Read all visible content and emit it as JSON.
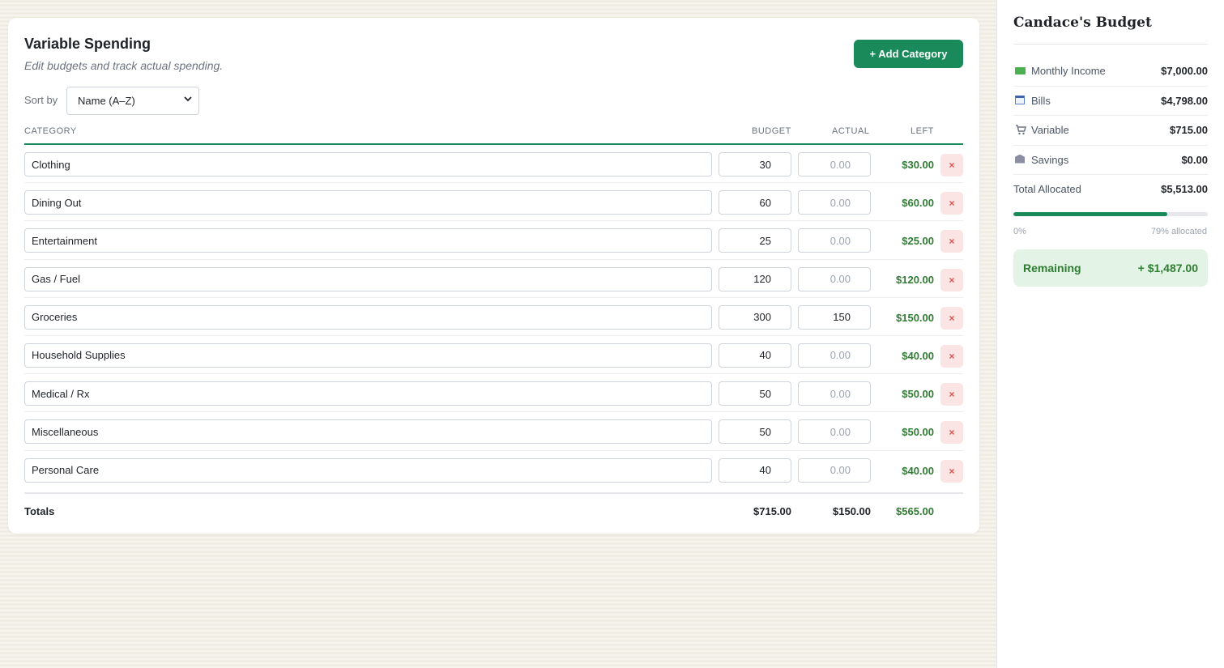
{
  "main": {
    "title": "Variable Spending",
    "subtitle": "Edit budgets and track actual spending.",
    "add_button": "+ Add Category",
    "sort_label": "Sort by",
    "sort_selected": "Name (A–Z)",
    "columns": {
      "category": "CATEGORY",
      "budget": "BUDGET",
      "actual": "ACTUAL",
      "left": "LEFT"
    },
    "rows": [
      {
        "name": "Clothing",
        "budget": "30",
        "actual": "",
        "actual_placeholder": "0.00",
        "left": "$30.00"
      },
      {
        "name": "Dining Out",
        "budget": "60",
        "actual": "",
        "actual_placeholder": "0.00",
        "left": "$60.00"
      },
      {
        "name": "Entertainment",
        "budget": "25",
        "actual": "",
        "actual_placeholder": "0.00",
        "left": "$25.00"
      },
      {
        "name": "Gas / Fuel",
        "budget": "120",
        "actual": "",
        "actual_placeholder": "0.00",
        "left": "$120.00"
      },
      {
        "name": "Groceries",
        "budget": "300",
        "actual": "150",
        "actual_placeholder": "0.00",
        "left": "$150.00"
      },
      {
        "name": "Household Supplies",
        "budget": "40",
        "actual": "",
        "actual_placeholder": "0.00",
        "left": "$40.00"
      },
      {
        "name": "Medical / Rx",
        "budget": "50",
        "actual": "",
        "actual_placeholder": "0.00",
        "left": "$50.00"
      },
      {
        "name": "Miscellaneous",
        "budget": "50",
        "actual": "",
        "actual_placeholder": "0.00",
        "left": "$50.00"
      },
      {
        "name": "Personal Care",
        "budget": "40",
        "actual": "",
        "actual_placeholder": "0.00",
        "left": "$40.00"
      }
    ],
    "delete_glyph": "×",
    "totals": {
      "label": "Totals",
      "budget": "$715.00",
      "actual": "$150.00",
      "left": "$565.00"
    }
  },
  "sidebar": {
    "title": "Candace's Budget",
    "items": [
      {
        "icon": "money-icon",
        "label": "Monthly Income",
        "value": "$7,000.00"
      },
      {
        "icon": "calendar-icon",
        "label": "Bills",
        "value": "$4,798.00"
      },
      {
        "icon": "cart-icon",
        "label": "Variable",
        "value": "$715.00"
      },
      {
        "icon": "bank-icon",
        "label": "Savings",
        "value": "$0.00"
      },
      {
        "icon": "",
        "label": "Total Allocated",
        "value": "$5,513.00"
      }
    ],
    "progress_fraction": 0.79,
    "progress_min": "0%",
    "progress_max": "79% allocated",
    "remaining_label": "Remaining",
    "remaining_value": "+ $1,487.00"
  },
  "colors": {
    "accent": "#1b8a5a",
    "positive": "#2f7d32",
    "delete_bg": "#fbe4e4",
    "delete_fg": "#d9534f",
    "remaining_bg": "#e3f3e5"
  }
}
